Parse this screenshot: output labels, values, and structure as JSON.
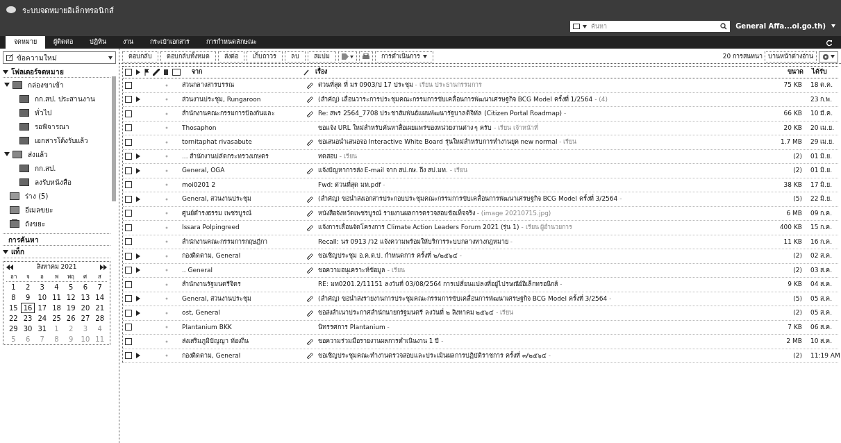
{
  "header": {
    "title": "ระบบจดหมายอิเล็กทรอนิกส์",
    "search_placeholder": "ค้นหา",
    "user": "General Affa...oi.go.th)"
  },
  "tabs": [
    {
      "label": "จดหมาย",
      "selected": true
    },
    {
      "label": "ผู้ติดต่อ",
      "selected": false
    },
    {
      "label": "ปฏิทิน",
      "selected": false
    },
    {
      "label": "งาน",
      "selected": false
    },
    {
      "label": "กระเป๋าเอกสาร",
      "selected": false
    },
    {
      "label": "การกำหนดลักษณะ",
      "selected": false
    }
  ],
  "new_message": "ข้อความใหม่",
  "toolbar": {
    "buttons": [
      "ตอบกลับ",
      "ตอบกลับทั้งหมด",
      "ส่งต่อ",
      "เก็บถาวร",
      "ลบ",
      "สแปม"
    ],
    "actions": "การดำเนินการ",
    "count": "20 การสนทนา",
    "view": "บานหน้าต่างอ่าน"
  },
  "folders": {
    "title": "โฟลเดอร์จดหมาย",
    "items": [
      {
        "label": "กล่องขาเข้า",
        "kind": "inbox",
        "expanded": true,
        "children": [
          {
            "label": "กก.สป. ประสานงาน",
            "kind": "folder"
          },
          {
            "label": "ทั่วไป",
            "kind": "folder"
          },
          {
            "label": "รอพิจารณา",
            "kind": "folder"
          },
          {
            "label": "เอกสารโต้งรับแล้ว",
            "kind": "folder"
          }
        ]
      },
      {
        "label": "ส่งแล้ว",
        "kind": "sent",
        "expanded": true,
        "children": [
          {
            "label": "กก.สป.",
            "kind": "folder"
          },
          {
            "label": "ลงรับหนังสือ",
            "kind": "folder"
          }
        ]
      },
      {
        "label": "ร่าง (5)",
        "kind": "drafts"
      },
      {
        "label": "อีเมลขยะ",
        "kind": "junk"
      },
      {
        "label": "ถังขยะ",
        "kind": "trash"
      }
    ]
  },
  "searches": "การค้นหา",
  "tags": "แท็ก",
  "calendar": {
    "month": "สิงหาคม 2021",
    "weekdays": [
      "อา",
      "จ",
      "อ",
      "พ",
      "พฤ",
      "ศ",
      "ส"
    ],
    "days": [
      {
        "d": "1",
        "outside": false,
        "selected": false
      },
      {
        "d": "2",
        "outside": false,
        "selected": false
      },
      {
        "d": "3",
        "outside": false,
        "selected": false
      },
      {
        "d": "4",
        "outside": false,
        "selected": false
      },
      {
        "d": "5",
        "outside": false,
        "selected": false
      },
      {
        "d": "6",
        "outside": false,
        "selected": false
      },
      {
        "d": "7",
        "outside": false,
        "selected": false
      },
      {
        "d": "8",
        "outside": false,
        "selected": false
      },
      {
        "d": "9",
        "outside": false,
        "selected": false
      },
      {
        "d": "10",
        "outside": false,
        "selected": false
      },
      {
        "d": "11",
        "outside": false,
        "selected": false
      },
      {
        "d": "12",
        "outside": false,
        "selected": false
      },
      {
        "d": "13",
        "outside": false,
        "selected": false
      },
      {
        "d": "14",
        "outside": false,
        "selected": false
      },
      {
        "d": "15",
        "outside": false,
        "selected": false
      },
      {
        "d": "16",
        "outside": false,
        "selected": true
      },
      {
        "d": "17",
        "outside": false,
        "selected": false
      },
      {
        "d": "18",
        "outside": false,
        "selected": false
      },
      {
        "d": "19",
        "outside": false,
        "selected": false
      },
      {
        "d": "20",
        "outside": false,
        "selected": false
      },
      {
        "d": "21",
        "outside": false,
        "selected": false
      },
      {
        "d": "22",
        "outside": false,
        "selected": false
      },
      {
        "d": "23",
        "outside": false,
        "selected": false
      },
      {
        "d": "24",
        "outside": false,
        "selected": false
      },
      {
        "d": "25",
        "outside": false,
        "selected": false
      },
      {
        "d": "26",
        "outside": false,
        "selected": false
      },
      {
        "d": "27",
        "outside": false,
        "selected": false
      },
      {
        "d": "28",
        "outside": false,
        "selected": false
      },
      {
        "d": "29",
        "outside": false,
        "selected": false
      },
      {
        "d": "30",
        "outside": false,
        "selected": false
      },
      {
        "d": "31",
        "outside": false,
        "selected": false
      },
      {
        "d": "1",
        "outside": true,
        "selected": false
      },
      {
        "d": "2",
        "outside": true,
        "selected": false
      },
      {
        "d": "3",
        "outside": true,
        "selected": false
      },
      {
        "d": "4",
        "outside": true,
        "selected": false
      },
      {
        "d": "5",
        "outside": true,
        "selected": false
      },
      {
        "d": "6",
        "outside": true,
        "selected": false
      },
      {
        "d": "7",
        "outside": true,
        "selected": false
      },
      {
        "d": "8",
        "outside": true,
        "selected": false
      },
      {
        "d": "9",
        "outside": true,
        "selected": false
      },
      {
        "d": "10",
        "outside": true,
        "selected": false
      },
      {
        "d": "11",
        "outside": true,
        "selected": false
      }
    ]
  },
  "columns": {
    "checked": false,
    "from": "จาก",
    "subject": "เรื่อง",
    "size": "ขนาด",
    "date": "ได้รับ"
  },
  "messages": [
    {
      "checked": false,
      "thread": false,
      "attachment": true,
      "from": "ส่วนกลางสารบรรณ",
      "subject": "ด่วนที่สุด ที่ มร 0903/ป 17 ประชุม",
      "fragment": " - เรียน ประธานกรรมการ",
      "size": "75 KB",
      "date": "18 ต.ค."
    },
    {
      "checked": false,
      "thread": true,
      "attachment": true,
      "from": "ส่วนงานประชุม, Rungaroon",
      "subject": "(สำคัญ) เลื่อนวาระการประชุมคณะกรรมการขับเคลื่อนการพัฒนาเศรษฐกิจ BCG Model ครั้งที่ 1/2564",
      "fragment": " - (4)",
      "date": "23 ก.พ."
    },
    {
      "checked": false,
      "thread": false,
      "attachment": true,
      "from": "สำนักงานคณะกรรมการป้องกันและ",
      "subject": "Re: สพร 2564_7708 ประชาสัมพันธ์แผนพัฒนารัฐบาลดิจิทัล (Citizen Portal Roadmap)",
      "fragment": " - ",
      "size": "66 KB",
      "date": "10 มี.ค."
    },
    {
      "checked": false,
      "thread": false,
      "attachment": false,
      "from": "Thosaphon",
      "subject": "ขอแจ้ง URL ใหม่สำหรับค้นหาสื่อเผยแพร่ของหน่วยงานต่าง ๆ ครับ",
      "fragment": " - เรียน เจ้าหน้าที่",
      "size": "20 KB",
      "date": "20 เม.ย."
    },
    {
      "checked": false,
      "thread": false,
      "attachment": true,
      "from": "tornitaphat rivasabute",
      "subject": "ขอเสนอนำเสนอจอ Interactive White Board รุ่นใหม่สำหรับการทำงานยุค new normal",
      "fragment": " - เรียน",
      "size": "1.7 MB",
      "date": "29 เม.ย."
    },
    {
      "checked": false,
      "thread": true,
      "attachment": false,
      "from": "... สำนักงานปลัดกระทรวงเกษตร",
      "subject": "ทดสอบ",
      "fragment": " - เรียน",
      "size": "(2)",
      "date": "01 มิ.ย."
    },
    {
      "checked": false,
      "thread": true,
      "attachment": true,
      "from": "General, OGA",
      "subject": "แจ้งปัญหาการส่ง E-mail จาก สป.กษ. ถึง สป.มท.",
      "fragment": " - เรียน",
      "size": "(2)",
      "date": "01 มิ.ย."
    },
    {
      "checked": false,
      "thread": false,
      "attachment": false,
      "from": "moi0201 2",
      "subject": "Fwd: ด่วนที่สุด มท.pdf",
      "fragment": " - ",
      "size": "38 KB",
      "date": "17 มิ.ย."
    },
    {
      "checked": false,
      "thread": true,
      "attachment": true,
      "from": "General, สวนงานประชุม",
      "subject": "(สำคัญ) ขอนำส่งเอกสารประกอบประชุมคณะกรรมการขับเคลื่อนการพัฒนาเศรษฐกิจ BCG Model ครั้งที่ 3/2564",
      "fragment": " - ",
      "size": "(5)",
      "date": "22 มิ.ย."
    },
    {
      "checked": false,
      "thread": false,
      "attachment": true,
      "from": "ศูนย์ดำรงธรรม เพชรบูรณ์",
      "subject": "หนังสือจังหวัดเพชรบูรณ์ รายงานผลการตรวจสอบข้อเท็จจริง",
      "fragment": " - (image 20210715.jpg)",
      "size": "6 MB",
      "date": "09 ก.ค."
    },
    {
      "checked": false,
      "thread": false,
      "attachment": true,
      "from": "Issara Polpingreed",
      "subject": "แจ้งการเลื่อนจัดโครงการ Climate Action Leaders Forum 2021 (รุ่น 1)",
      "fragment": " - เรียน ผู้อำนวยการ",
      "size": "400 KB",
      "date": "15 ก.ค."
    },
    {
      "checked": false,
      "thread": false,
      "attachment": false,
      "from": "สำนักงานคณะกรรมการกฤษฎีกา",
      "subject": "Recall: นร 0913 /ว2 แจ้งความพร้อมให้บริการระบบกลางทางกฎหมาย",
      "fragment": " - ",
      "size": "11 KB",
      "date": "16 ก.ค."
    },
    {
      "checked": false,
      "thread": true,
      "attachment": true,
      "from": "กองติดตาม, General",
      "subject": "ขอเชิญประชุม อ.ค.ต.ป. กำหนดการ ครั้งที่ ๒/๒๕๖๔",
      "fragment": " - ",
      "size": "(2)",
      "date": "02 ส.ค."
    },
    {
      "checked": false,
      "thread": true,
      "attachment": true,
      "from": ".. General",
      "subject": "ขอความอนุเคราะห์ข้อมูล",
      "fragment": " - เรียน",
      "size": "(2)",
      "date": "03 ส.ค."
    },
    {
      "checked": false,
      "thread": false,
      "attachment": false,
      "from": "สำนักงานรัฐมนตรีจิตร",
      "subject": "RE: มท0201.2/11151 ลงวันที่ 03/08/2564 การเปลี่ยนแปลงที่อยู่ไปรษณีย์อิเล็กทรอนิกส์",
      "fragment": " - ",
      "size": "9 KB",
      "date": "04 ส.ค."
    },
    {
      "checked": false,
      "thread": true,
      "attachment": true,
      "from": "General, ส่วนงานประชุม",
      "subject": "(สำคัญ) ขอนำส่งรายงานการประชุมคณะกรรมการขับเคลื่อนการพัฒนาเศรษฐกิจ BCG Model ครั้งที่ 3/2564",
      "fragment": " - ",
      "size": "(5)",
      "date": "05 ส.ค."
    },
    {
      "checked": false,
      "thread": true,
      "attachment": true,
      "from": "ost, General",
      "subject": "ขอส่งสำเนาประกาศสำนักนายกรัฐมนตรี ลงวันที่ ๒ สิงหาคม ๒๕๖๔",
      "fragment": " - เรียน",
      "size": "(2)",
      "date": "05 ส.ค."
    },
    {
      "checked": false,
      "thread": false,
      "attachment": false,
      "from": "Plantanium BKK",
      "subject": "นิทรรศการ Plantanium",
      "fragment": " - ",
      "size": "7 KB",
      "date": "06 ส.ค."
    },
    {
      "checked": false,
      "thread": false,
      "attachment": true,
      "from": "ส่งเสริมภูมิปัญญา ท้องถิ่น",
      "subject": "ขอความร่วมมือรายงานผลการดำเนินงาน 1 ปี",
      "fragment": " - ",
      "size": "2 MB",
      "date": "10 ส.ค."
    },
    {
      "checked": false,
      "thread": true,
      "attachment": true,
      "from": "กองติดตาม, General",
      "subject": "ขอเชิญประชุมคณะทำงานตรวจสอบและประเมินผลการปฏิบัติราชการ ครั้งที่ ๓/๒๕๖๔",
      "fragment": " - ",
      "size": "(2)",
      "date": "11:19 AM"
    }
  ]
}
